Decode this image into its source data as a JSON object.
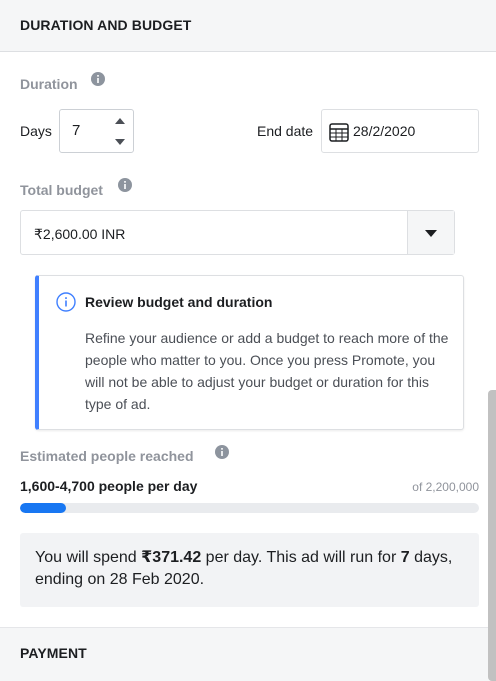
{
  "section_duration": {
    "title": "DURATION AND BUDGET"
  },
  "duration": {
    "label": "Duration",
    "days_label": "Days",
    "days_value": "7",
    "end_date_label": "End date",
    "end_date_value": "28/2/2020"
  },
  "budget": {
    "label": "Total budget",
    "selected": "₹2,600.00 INR"
  },
  "notice": {
    "title": "Review budget and duration",
    "body": "Refine your audience or add a budget to reach more of the people who matter to you. Once you press Promote, you will not be able to adjust your budget or duration for this type of ad."
  },
  "reach": {
    "label": "Estimated people reached",
    "value": "1,600-4,700 people per day",
    "total": "of 2,200,000",
    "progress_fraction": 0.1
  },
  "spend": {
    "prefix": "You will spend ",
    "amount": "₹371.42",
    "middle": " per day. This ad will run for ",
    "days": "7",
    "suffix": " days, ending on 28 Feb 2020."
  },
  "section_payment": {
    "title": "PAYMENT"
  },
  "colors": {
    "accent": "#1877f2",
    "notice_border": "#4080ff",
    "muted_label": "#90949c"
  },
  "icons": {
    "info": "info-icon",
    "calendar": "calendar-icon",
    "caret": "caret-down-icon"
  }
}
